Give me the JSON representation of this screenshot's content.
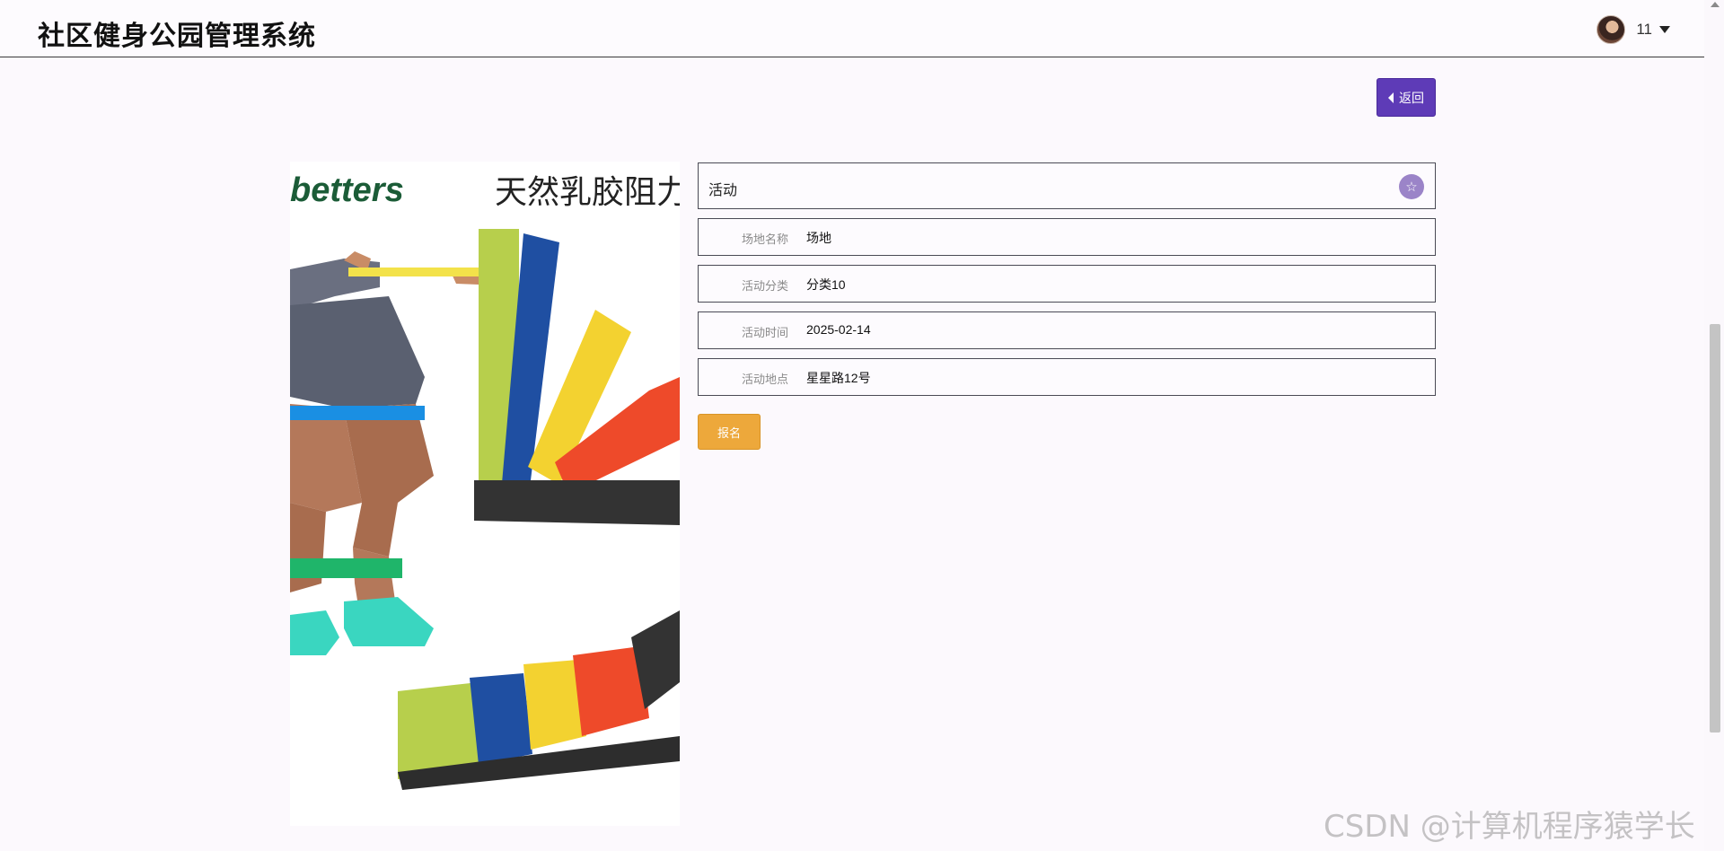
{
  "header": {
    "app_title": "社区健身公园管理系统",
    "username": "11"
  },
  "toolbar": {
    "back_label": "返回"
  },
  "product_image": {
    "brand_text": "betters",
    "headline_text": "天然乳胶阻力"
  },
  "detail": {
    "title": "活动",
    "fields": [
      {
        "label": "场地名称",
        "value": "场地"
      },
      {
        "label": "活动分类",
        "value": "分类10"
      },
      {
        "label": "活动时间",
        "value": "2025-02-14"
      },
      {
        "label": "活动地点",
        "value": "星星路12号"
      }
    ],
    "signup_label": "报名"
  },
  "watermark": "CSDN @计算机程序猿学长",
  "icons": {
    "avatar": "user-avatar",
    "caret": "caret-down-icon",
    "back": "caret-left-icon",
    "favorite": "star-icon"
  },
  "colors": {
    "back_button": "#5e3bb7",
    "signup_button": "#eda83b",
    "favorite_button": "#9b84c8"
  }
}
